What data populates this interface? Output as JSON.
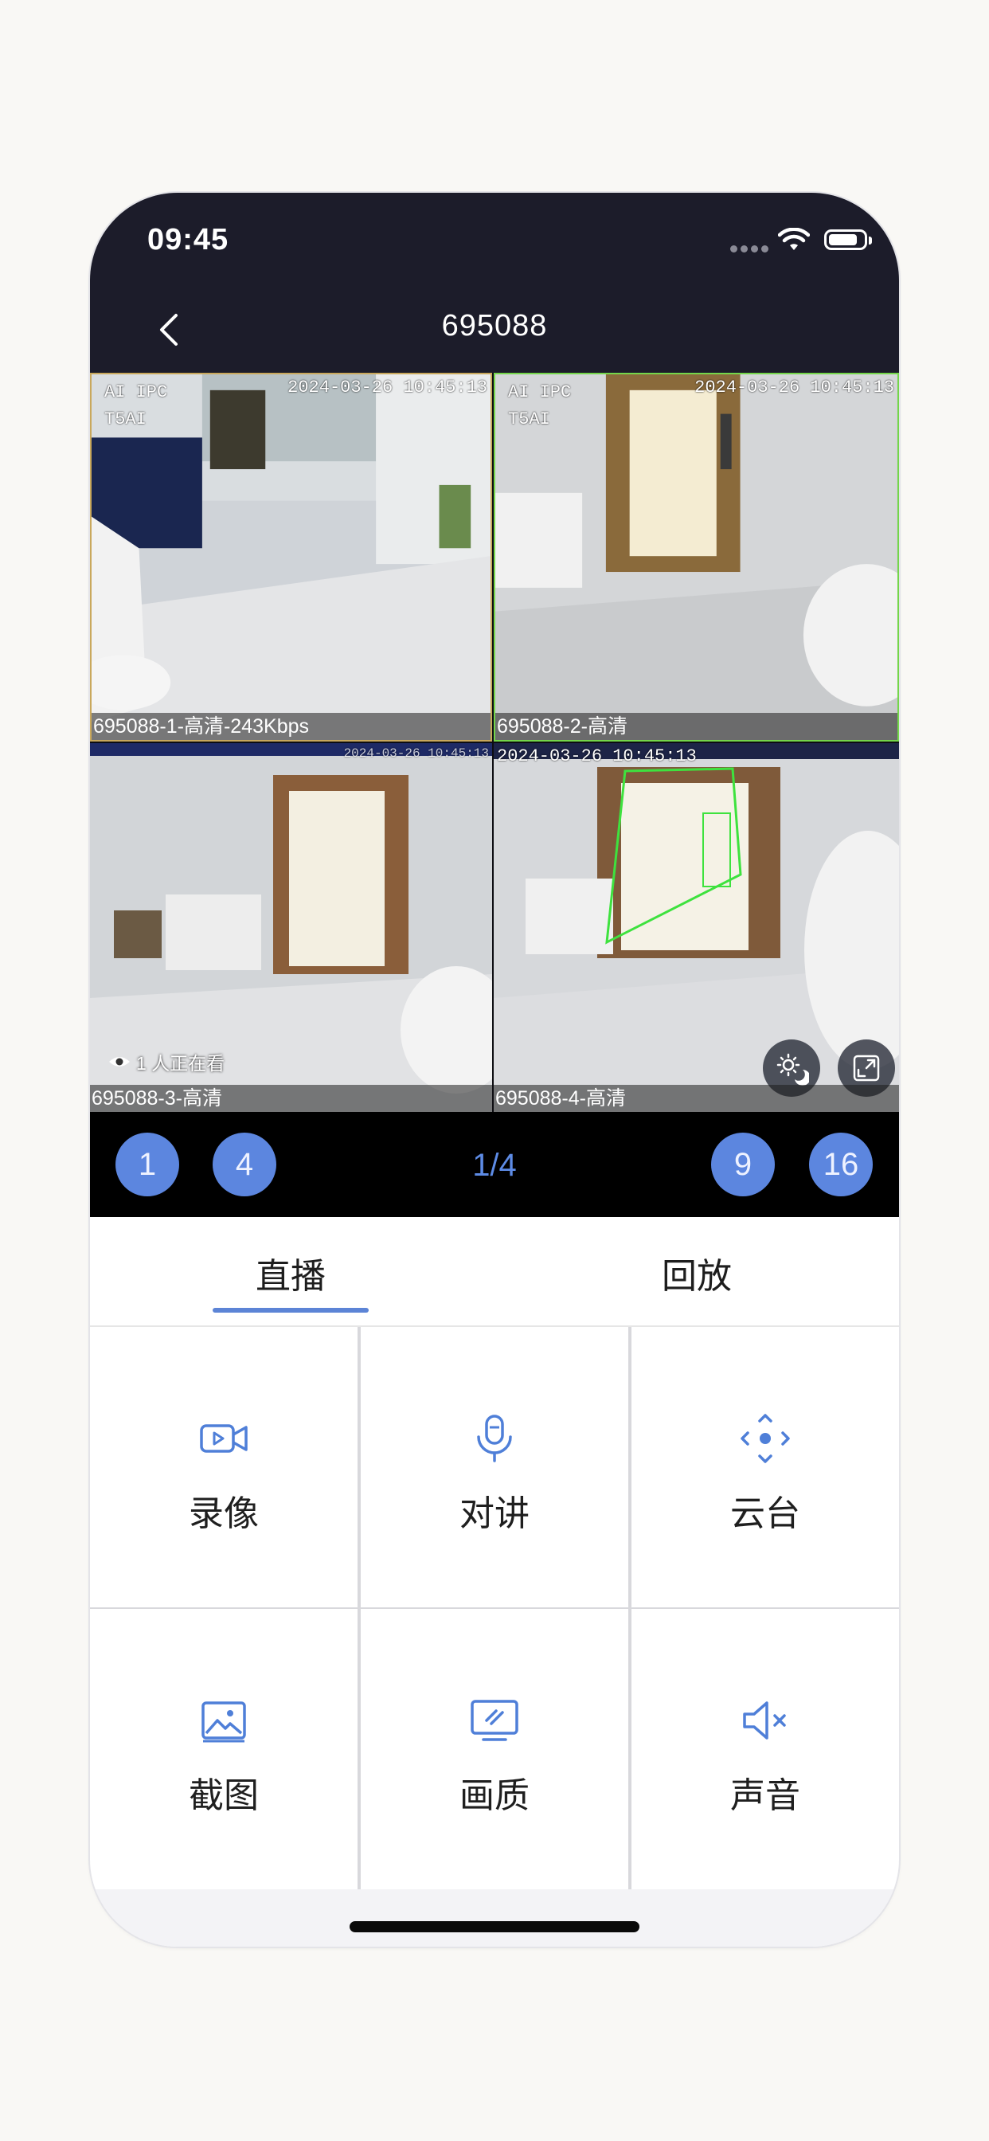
{
  "status_bar": {
    "time": "09:45"
  },
  "header": {
    "title": "695088"
  },
  "cameras": [
    {
      "label": "695088-1-高清-243Kbps",
      "timestamp": "2024-03-26 10:45:13",
      "osd_lines": [
        "AI IPC",
        "T5AI"
      ]
    },
    {
      "label": "695088-2-高清",
      "timestamp": "2024-03-26 10:45:13",
      "osd_lines": [
        "AI IPC",
        "T5AI"
      ]
    },
    {
      "label": "695088-3-高清",
      "timestamp": "2024-03-26 10:45:13"
    },
    {
      "label": "695088-4-高清",
      "timestamp": "2024-03-26 10:45:13"
    }
  ],
  "viewers": "1 人正在看",
  "split": {
    "options": [
      "1",
      "4",
      "9",
      "16"
    ],
    "page": "1/4"
  },
  "tabs": [
    {
      "label": "直播",
      "active": true
    },
    {
      "label": "回放",
      "active": false
    }
  ],
  "functions": [
    {
      "label": "录像",
      "icon": "video-icon"
    },
    {
      "label": "对讲",
      "icon": "microphone-icon"
    },
    {
      "label": "云台",
      "icon": "ptz-icon"
    },
    {
      "label": "截图",
      "icon": "screenshot-icon"
    },
    {
      "label": "画质",
      "icon": "quality-icon"
    },
    {
      "label": "声音",
      "icon": "mute-icon"
    }
  ],
  "colors": {
    "accent": "#5c86df",
    "header_bg": "#1c1c2a",
    "icon": "#4f7fd8"
  }
}
